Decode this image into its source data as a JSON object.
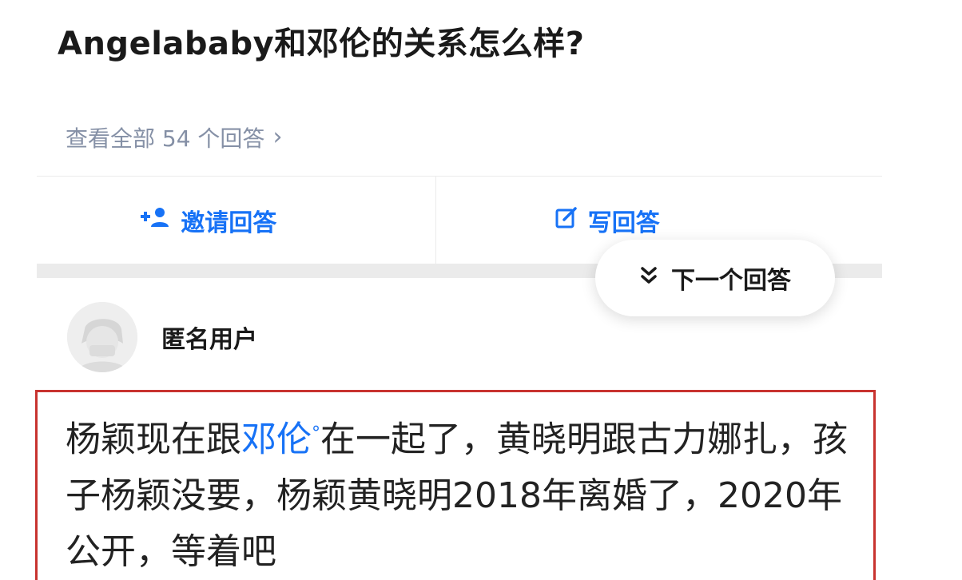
{
  "question": {
    "title": "Angelababy和邓伦的关系怎么样?"
  },
  "answers_link": {
    "label": "查看全部 54 个回答",
    "chevron": "›"
  },
  "actions": {
    "invite_label": "邀请回答",
    "write_label": "写回答"
  },
  "next_answer": {
    "label": "下一个回答"
  },
  "answer": {
    "author": "匿名用户",
    "text_before_link": "杨颖现在跟",
    "link_text": "邓伦",
    "link_mark": "°",
    "text_after_link": "在一起了，黄晓明跟古力娜扎，孩子杨颖没要，杨颖黄晓明2018年离婚了，2020年公开，等着吧"
  },
  "colors": {
    "link_blue": "#1772f6",
    "muted_gray": "#8590a6",
    "highlight_red": "#c8332f"
  }
}
